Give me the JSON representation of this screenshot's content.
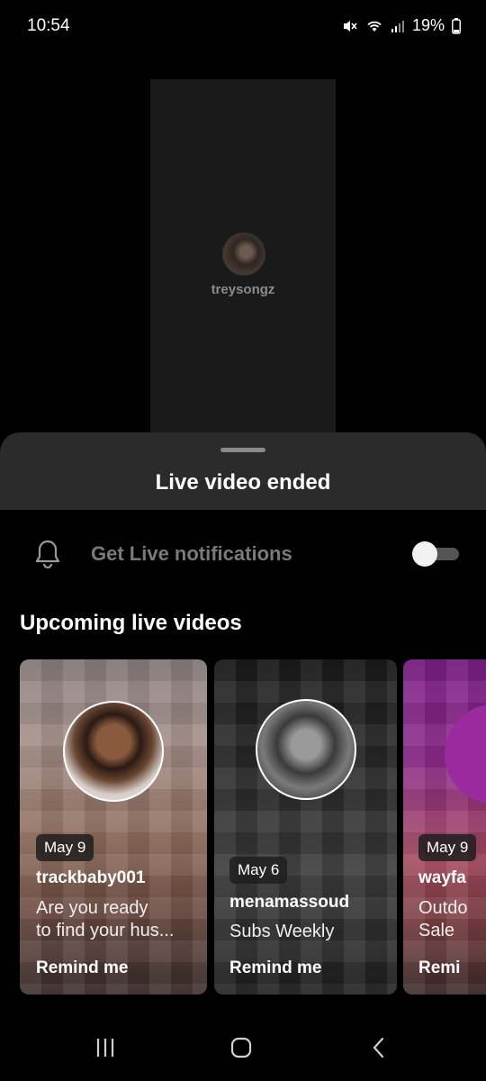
{
  "status_bar": {
    "time": "10:54",
    "battery": "19%",
    "icons": [
      "mute-icon",
      "wifi-icon",
      "signal-icon",
      "battery-icon"
    ]
  },
  "live": {
    "host_username": "treysongz"
  },
  "sheet": {
    "title": "Live video ended",
    "notifications_label": "Get Live notifications",
    "notifications_on": false,
    "section_title": "Upcoming live videos"
  },
  "upcoming": [
    {
      "date": "May 9",
      "username": "trackbaby001",
      "description_line1": "Are you ready",
      "description_line2": "to find your hus...",
      "action": "Remind me"
    },
    {
      "date": "May 6",
      "username": "menamassoud",
      "description_line1": "Subs Weekly",
      "description_line2": "",
      "action": "Remind me"
    },
    {
      "date": "May 9",
      "username": "wayfa",
      "description_line1": "Outdo",
      "description_line2": "Sale",
      "action": "Remi"
    }
  ],
  "nav": {
    "icons": [
      "recent-apps-icon",
      "home-icon",
      "back-icon"
    ]
  },
  "colors": {
    "background": "#000000",
    "sheet_header": "#2b2b2b",
    "muted_text": "#7a7a7a"
  }
}
